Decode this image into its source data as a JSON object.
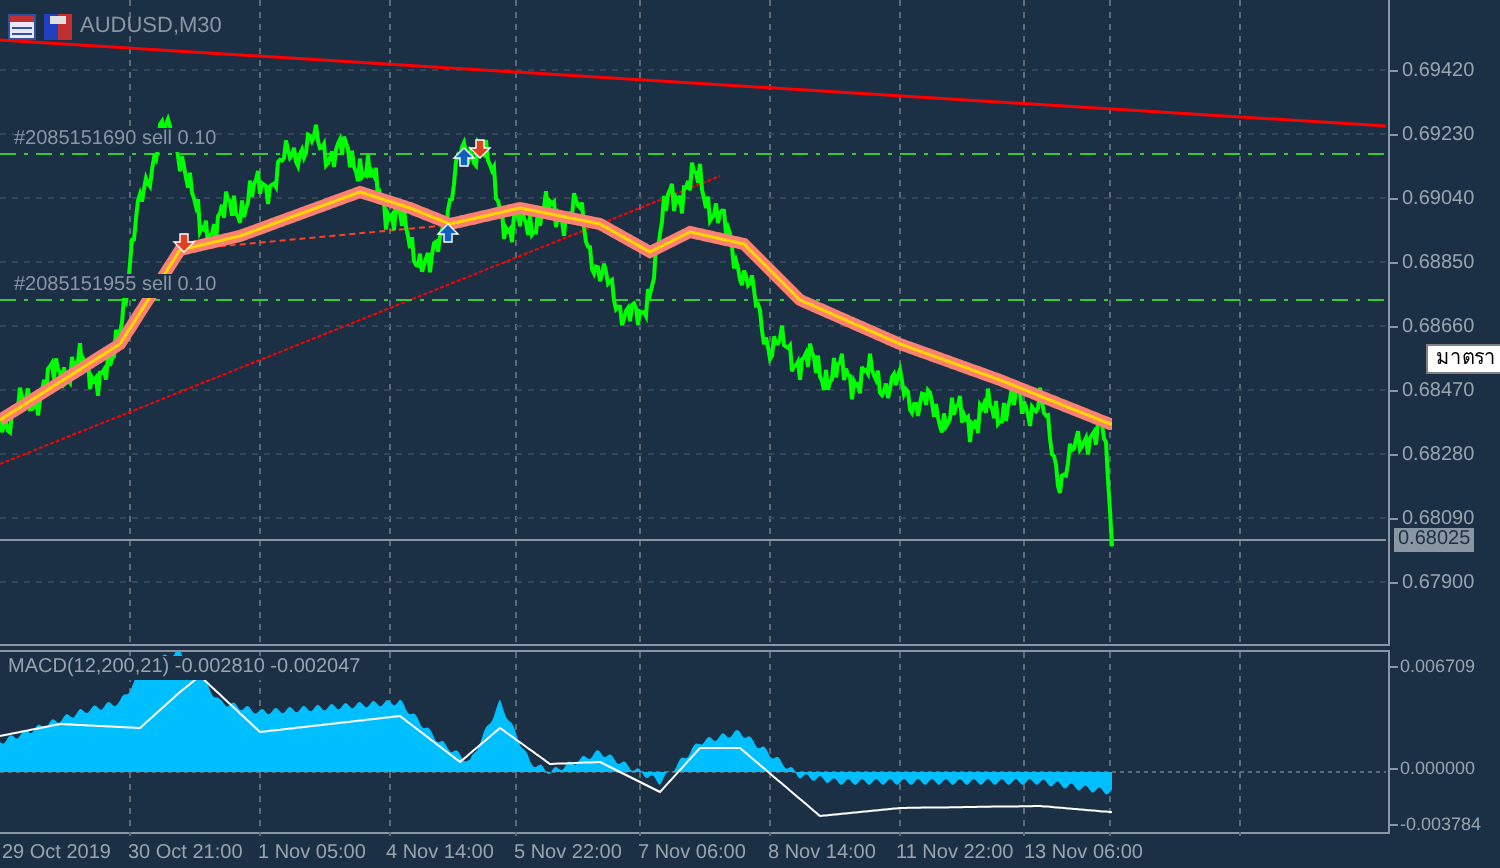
{
  "window": {
    "title": "AUDUSD,M30"
  },
  "orders": [
    {
      "label": "#2085151690 sell 0.10"
    },
    {
      "label": "#2085151955 sell 0.10"
    }
  ],
  "price_axis": {
    "ticks": [
      "0.69420",
      "0.69230",
      "0.69040",
      "0.68850",
      "0.68660",
      "0.68470",
      "0.68280",
      "0.68090",
      "0.67900"
    ],
    "current_price": "0.68025"
  },
  "tooltip": {
    "text": "มาตรา"
  },
  "macd": {
    "label": "MACD(12,200,21) -0.002810 -0.002047",
    "ticks": [
      "0.006709",
      "0.000000",
      "-0.003784"
    ]
  },
  "time_axis": {
    "labels": [
      "29 Oct 2019",
      "30 Oct 21:00",
      "1 Nov 05:00",
      "4 Nov 14:00",
      "5 Nov 22:00",
      "7 Nov 06:00",
      "8 Nov 14:00",
      "11 Nov 22:00",
      "13 Nov 06:00"
    ]
  }
}
